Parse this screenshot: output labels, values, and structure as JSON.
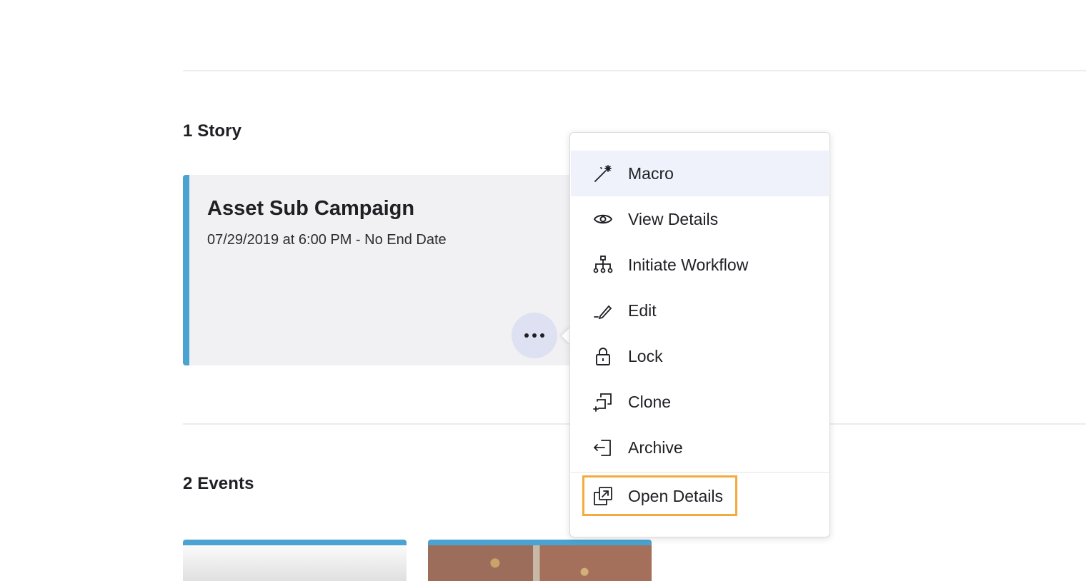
{
  "stories": {
    "heading": "1 Story",
    "card": {
      "title": "Asset Sub Campaign",
      "date": "07/29/2019 at 6:00 PM - No End Date",
      "accent_color": "#4aa3d0"
    }
  },
  "events": {
    "heading": "2 Events"
  },
  "menu": {
    "items": [
      {
        "label": "Macro",
        "icon": "magic-wand-icon",
        "active": true
      },
      {
        "label": "View Details",
        "icon": "eye-icon"
      },
      {
        "label": "Initiate Workflow",
        "icon": "workflow-tree-icon"
      },
      {
        "label": "Edit",
        "icon": "pencil-icon"
      },
      {
        "label": "Lock",
        "icon": "lock-icon"
      },
      {
        "label": "Clone",
        "icon": "clone-icon"
      },
      {
        "label": "Archive",
        "icon": "archive-icon"
      },
      {
        "label": "Open Details",
        "icon": "open-external-icon",
        "highlighted": true
      }
    ]
  },
  "colors": {
    "accent": "#4aa3d0",
    "highlight": "#f2ab3c",
    "active_row": "#eff2fb"
  }
}
